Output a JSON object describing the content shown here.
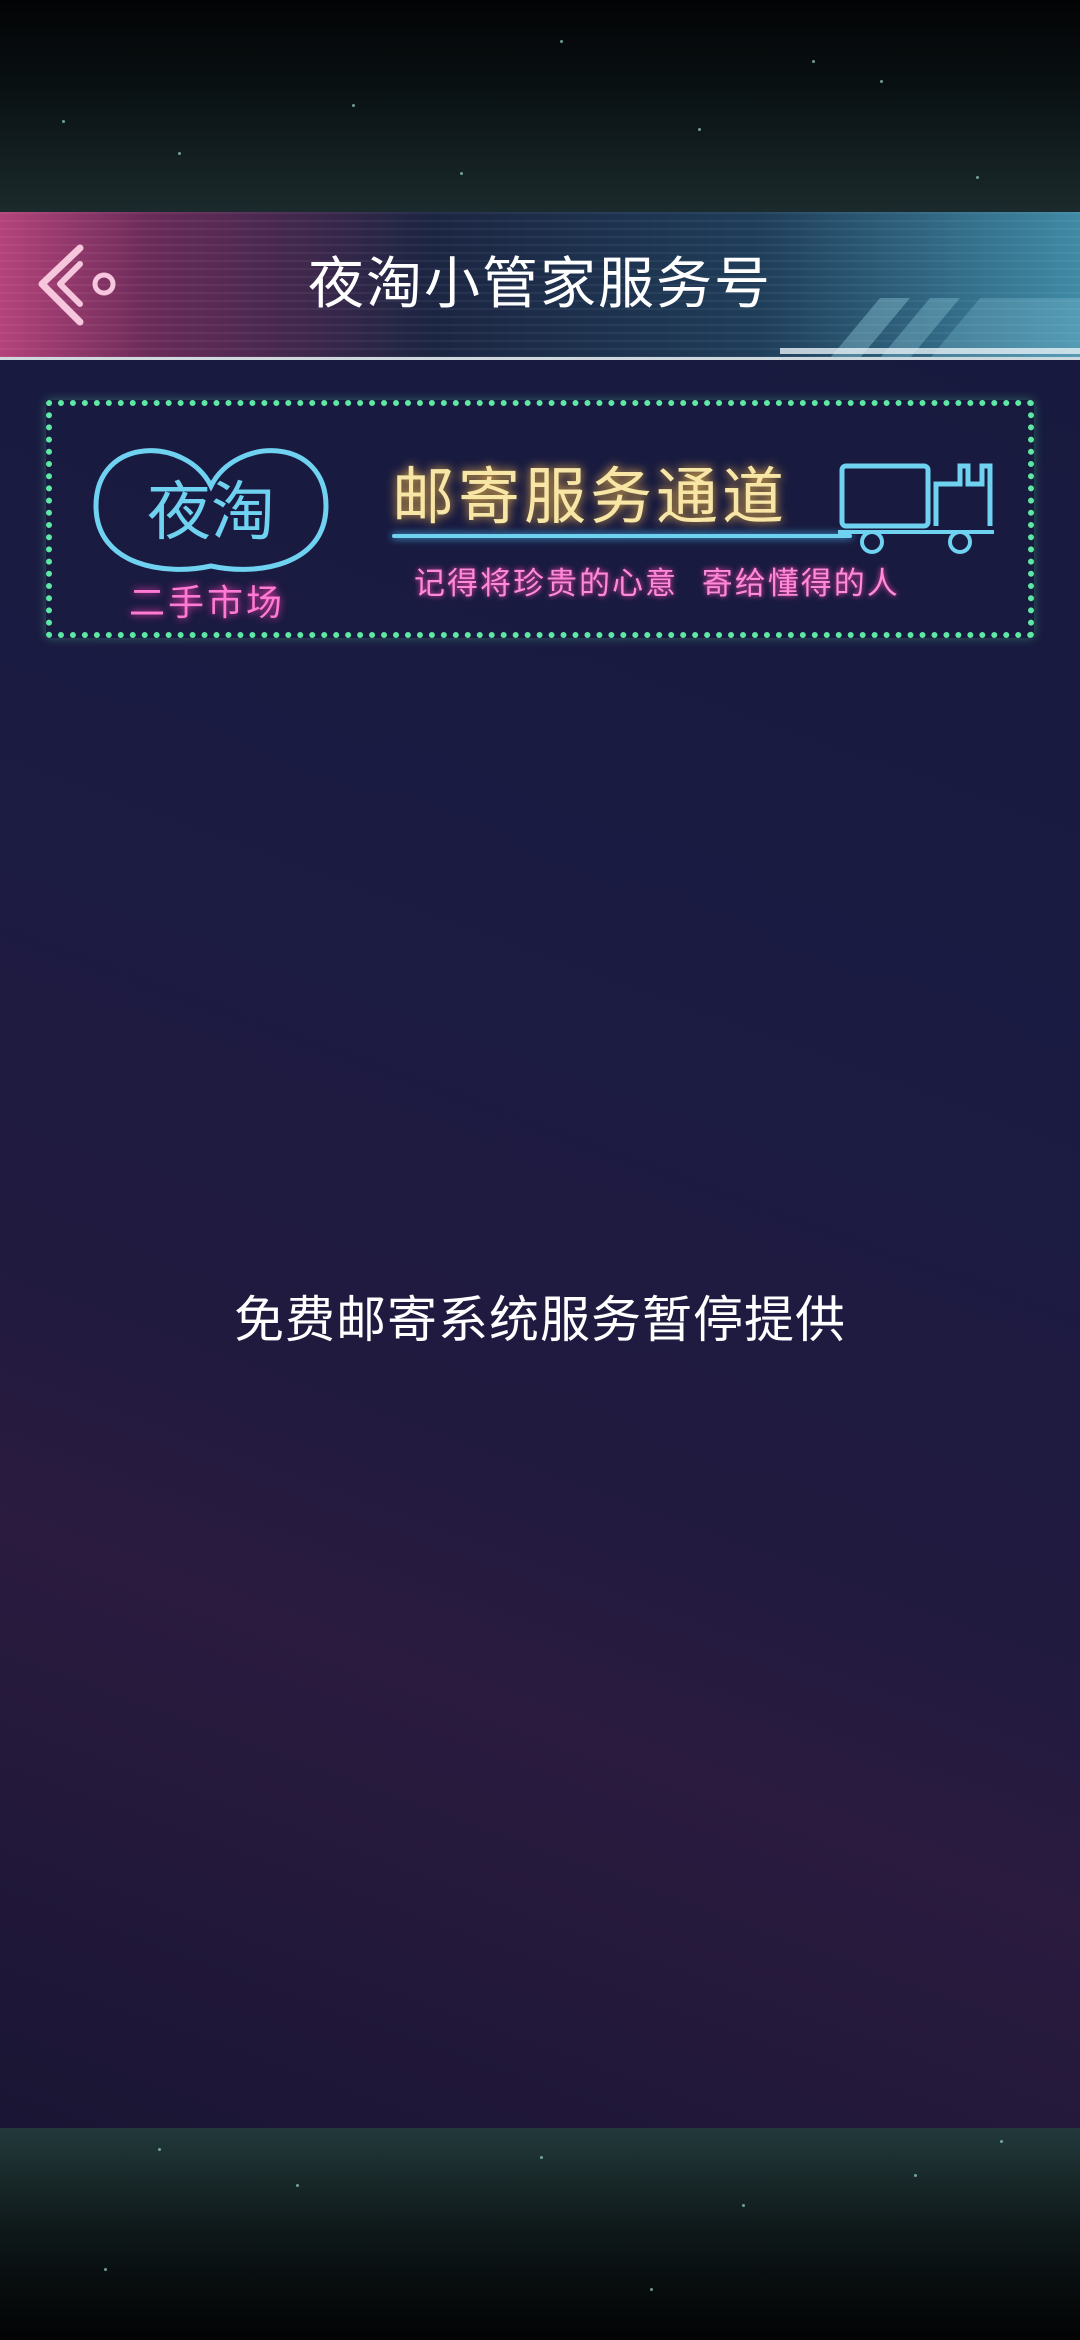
{
  "header": {
    "title": "夜淘小管家服务号",
    "back_icon": "chevron-left-icon"
  },
  "banner": {
    "logo_text": "夜淘",
    "logo_subtitle": "二手市场",
    "title": "邮寄服务通道",
    "subtitle": "记得将珍贵的心意  寄给懂得的人",
    "truck_icon": "truck-icon",
    "colors": {
      "dots": "#5ee8a4",
      "logo": "#6fd2f0",
      "pink": "#ff7ad2",
      "title": "#f7e6a6"
    }
  },
  "main": {
    "notice": "免费邮寄系统服务暂停提供"
  }
}
